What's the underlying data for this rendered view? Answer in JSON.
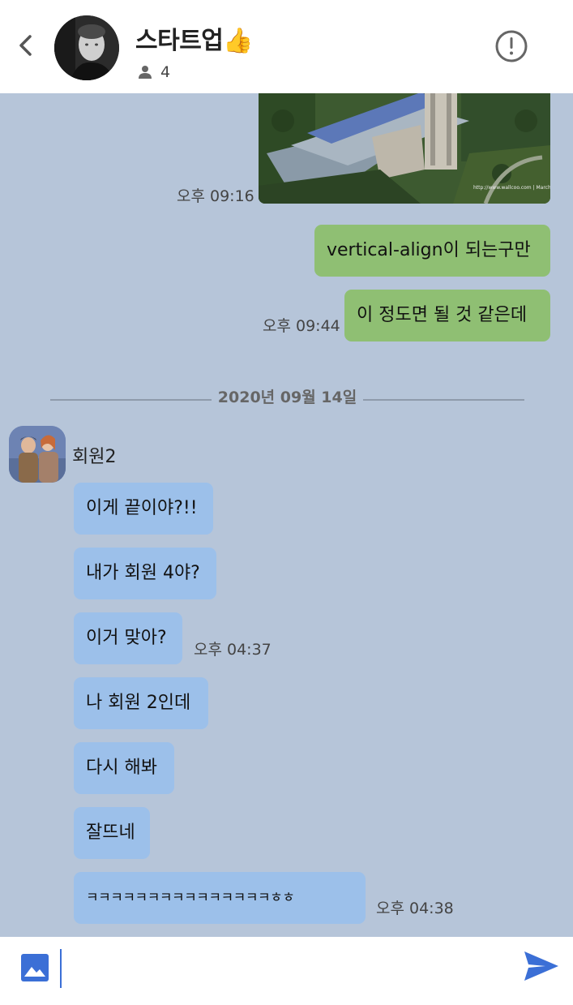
{
  "header": {
    "title": "스타트업",
    "title_emoji": "👍",
    "member_count": "4"
  },
  "chat": {
    "photo_time": "오후 09:16",
    "my_messages": [
      {
        "text": "vertical-align이 되는구만",
        "time": ""
      },
      {
        "text": "이 정도면 될 것 같은데",
        "time": "오후 09:44"
      }
    ],
    "date_separator": "2020년 09월 14일",
    "sender_name": "회원2",
    "other_messages": [
      {
        "text": "이게 끝이야?!!",
        "time": ""
      },
      {
        "text": "내가 회원 4야?",
        "time": ""
      },
      {
        "text": "이거 맞아?",
        "time": "오후 04:37"
      },
      {
        "text": "나 회원 2인데",
        "time": ""
      },
      {
        "text": "다시 해봐",
        "time": ""
      },
      {
        "text": "잘뜨네",
        "time": ""
      },
      {
        "text": "ㅋㅋㅋㅋㅋㅋㅋㅋㅋㅋㅋㅋㅋㅋㅋㅎㅎ",
        "time": "오후 04:38"
      }
    ]
  },
  "input": {
    "value": "",
    "placeholder": ""
  },
  "icons": {
    "back": "chevron-left-icon",
    "info": "alert-circle-icon",
    "members": "person-icon",
    "image": "image-icon",
    "send": "send-icon"
  },
  "colors": {
    "chat_background": "#b6c5d9",
    "my_bubble": "#8fbf73",
    "other_bubble": "#9cc0ea",
    "accent": "#3b6fd6"
  }
}
